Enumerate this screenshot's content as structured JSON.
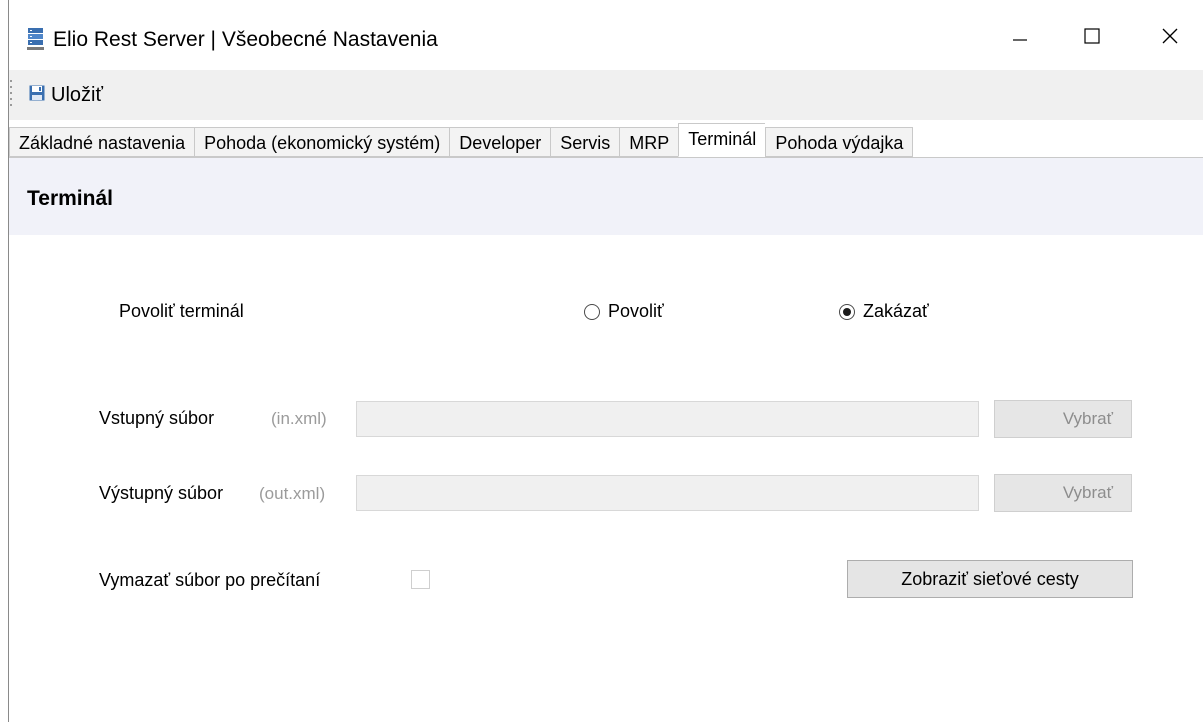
{
  "window": {
    "title": "Elio Rest Server | Všeobecné Nastavenia",
    "app_icon": "server-stack-icon",
    "controls": {
      "minimize": "minimize-icon",
      "maximize": "maximize-icon",
      "close": "close-icon"
    }
  },
  "toolbar": {
    "save_label": "Uložiť",
    "save_icon": "floppy-disk-icon"
  },
  "tabs": [
    {
      "label": "Základné nastavenia",
      "active": false
    },
    {
      "label": "Pohoda (ekonomický systém)",
      "active": false
    },
    {
      "label": "Developer",
      "active": false
    },
    {
      "label": "Servis",
      "active": false
    },
    {
      "label": "MRP",
      "active": false
    },
    {
      "label": "Terminál",
      "active": true
    },
    {
      "label": "Pohoda výdajka",
      "active": false
    }
  ],
  "section": {
    "title": "Terminál"
  },
  "terminal": {
    "enable_label": "Povoliť terminál",
    "options": [
      {
        "label": "Povoliť",
        "checked": false
      },
      {
        "label": "Zakázať",
        "checked": true
      }
    ]
  },
  "input_file": {
    "label": "Vstupný súbor",
    "hint": "(in.xml)",
    "value": "",
    "button": "Vybrať"
  },
  "output_file": {
    "label": "Výstupný súbor",
    "hint": "(out.xml)",
    "value": "",
    "button": "Vybrať"
  },
  "delete_after_read": {
    "label": "Vymazať súbor po prečítaní",
    "checked": false
  },
  "show_network_paths": {
    "label": "Zobraziť sieťové cesty"
  },
  "colors": {
    "header_bg": "#f1f2f9",
    "toolbar_bg": "#f0f0f0",
    "disabled_text": "#8d8d8d",
    "icon_blue": "#3a6fb0"
  }
}
